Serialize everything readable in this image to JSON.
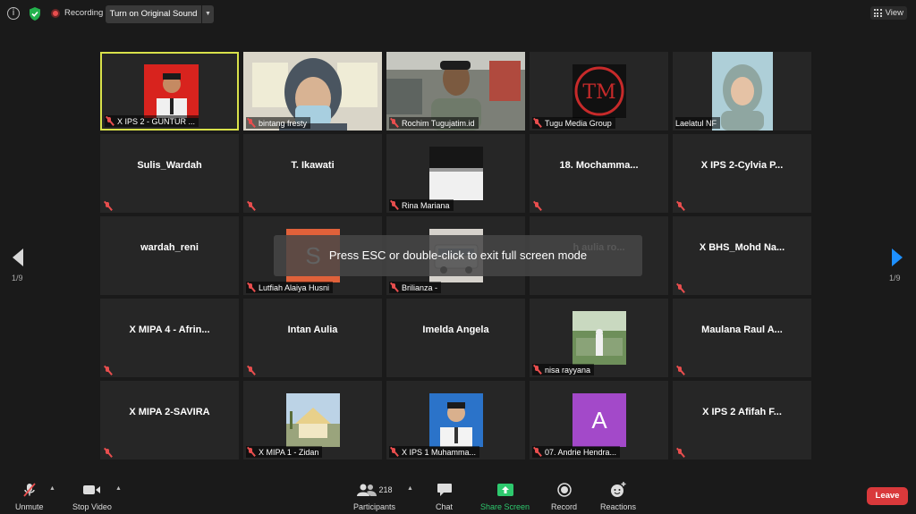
{
  "topbar": {
    "recording_label": "Recording",
    "sound_button_label": "Turn on Original Sound",
    "view_label": "View"
  },
  "grid": {
    "tiles": [
      {
        "label": "X IPS 2 - GUNTUR ...",
        "active": true
      },
      {
        "label": "bintang fresty"
      },
      {
        "label": "Rochim Tugujatim.id"
      },
      {
        "label": "Tugu Media Group"
      },
      {
        "label": "Laelatul NF"
      },
      {
        "name": "Sulis_Wardah"
      },
      {
        "name": "T. Ikawati"
      },
      {
        "label": "Rina Mariana"
      },
      {
        "name": "18. Mochamma..."
      },
      {
        "name": "X IPS 2-Cylvia P..."
      },
      {
        "name": "wardah_reni"
      },
      {
        "label": "Lutfiah Alaiya Husni",
        "initial": "S"
      },
      {
        "label": "Brilianza -"
      },
      {
        "name": "h aulia ro..."
      },
      {
        "name": "X BHS_Mohd Na..."
      },
      {
        "name": "X MIPA 4 - Afrin..."
      },
      {
        "name": "Intan Aulia"
      },
      {
        "name": "Imelda Angela"
      },
      {
        "label": "nisa rayyana"
      },
      {
        "name": "Maulana Raul A..."
      },
      {
        "name": "X MIPA 2-SAVIRA"
      },
      {
        "label": "X MIPA 1 - Zidan"
      },
      {
        "label": "X IPS 1 Muhamma..."
      },
      {
        "label": "07. Andrie Hendra...",
        "initial": "A"
      },
      {
        "name": "X IPS 2 Afifah F..."
      }
    ]
  },
  "navigation": {
    "page_left": "1/9",
    "page_right": "1/9"
  },
  "banner": {
    "text": "Press ESC or double-click to exit full screen mode"
  },
  "toolbar": {
    "unmute_label": "Unmute",
    "stop_video_label": "Stop Video",
    "participants_label": "Participants",
    "participants_count": "218",
    "chat_label": "Chat",
    "share_label": "Share Screen",
    "record_label": "Record",
    "reactions_label": "Reactions",
    "leave_label": "Leave"
  },
  "colors": {
    "active_border": "#d8e14a",
    "share_green": "#2ec96e",
    "leave_red": "#d9393b",
    "nav_blue": "#1e90ff",
    "muted_red": "#e84e4e"
  }
}
